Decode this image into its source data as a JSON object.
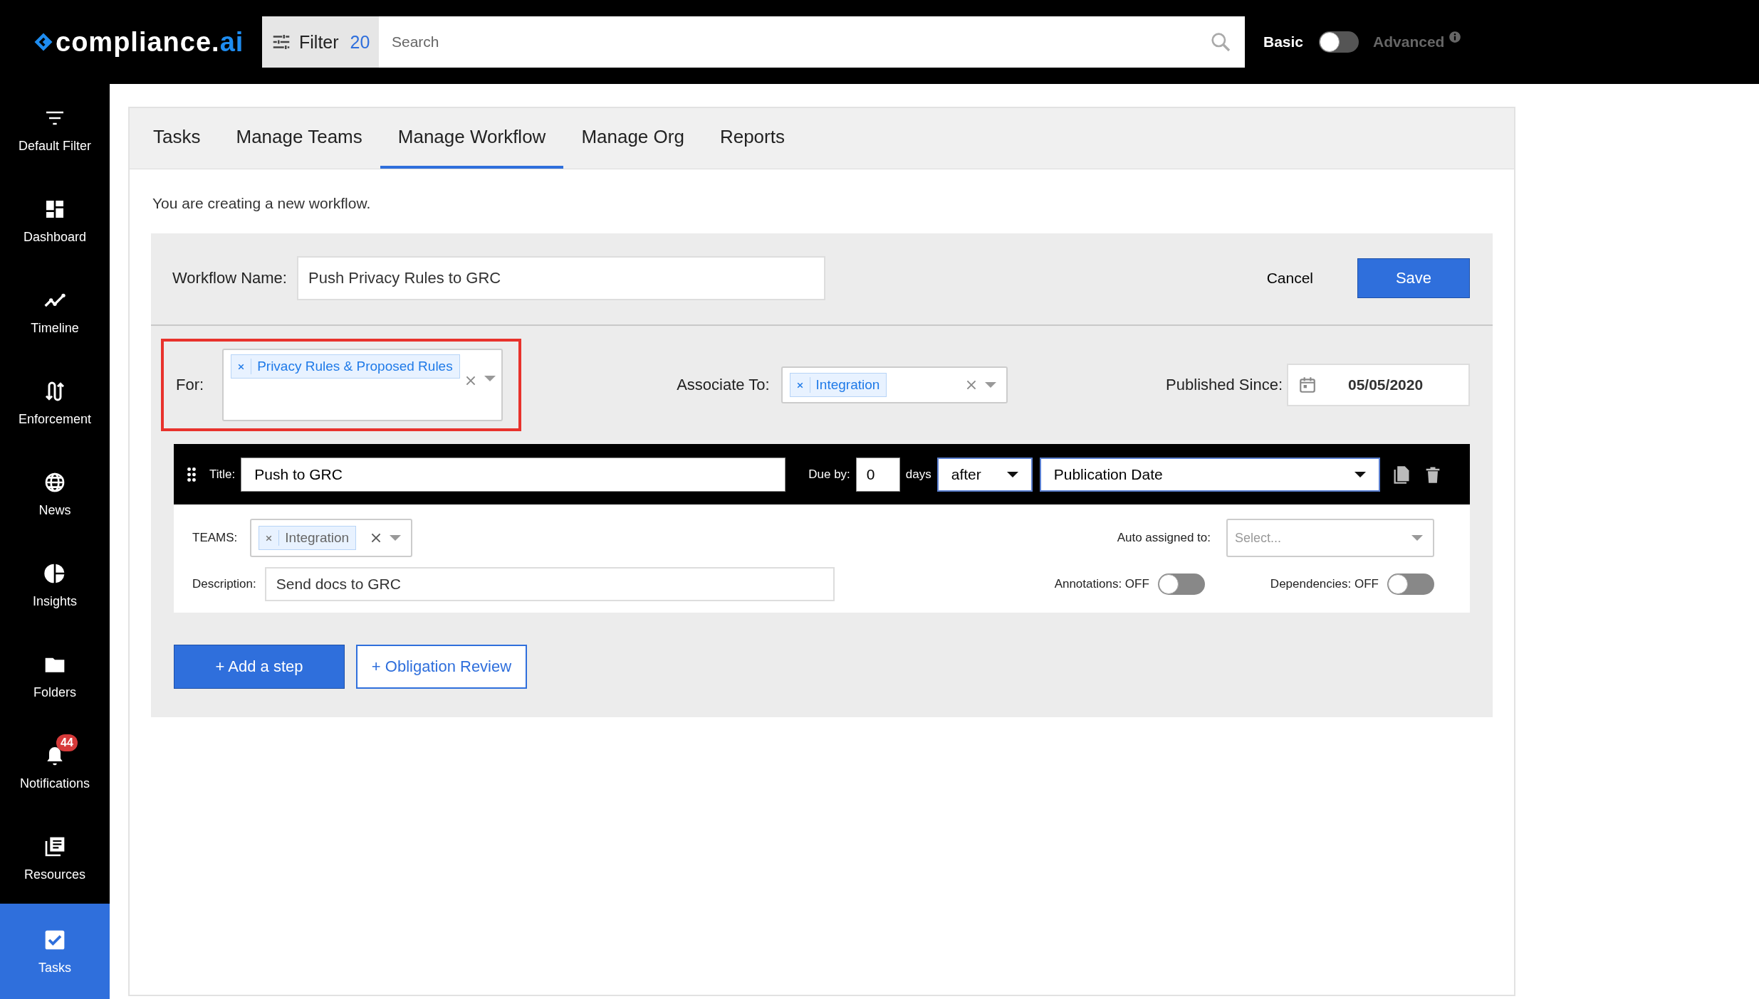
{
  "header": {
    "logo": "compliance.",
    "logo_accent": "ai",
    "filter_label": "Filter",
    "filter_count": "20",
    "search_placeholder": "Search",
    "mode_basic": "Basic",
    "mode_advanced": "Advanced",
    "advanced": false
  },
  "sidebar": {
    "items": [
      {
        "label": "Default Filter",
        "selected": false
      },
      {
        "label": "Dashboard",
        "selected": false
      },
      {
        "label": "Timeline",
        "selected": false
      },
      {
        "label": "Enforcement",
        "selected": false
      },
      {
        "label": "News",
        "selected": false
      },
      {
        "label": "Insights",
        "selected": false
      },
      {
        "label": "Folders",
        "selected": false
      },
      {
        "label": "Notifications",
        "selected": false,
        "badge": "44"
      },
      {
        "label": "Resources",
        "selected": false
      },
      {
        "label": "Tasks",
        "selected": true
      }
    ]
  },
  "tabs": [
    {
      "label": "Tasks",
      "selected": false
    },
    {
      "label": "Manage Teams",
      "selected": false
    },
    {
      "label": "Manage Workflow",
      "selected": true
    },
    {
      "label": "Manage Org",
      "selected": false
    },
    {
      "label": "Reports",
      "selected": false
    }
  ],
  "intro": "You are creating a new workflow.",
  "workflow": {
    "name_label": "Workflow Name:",
    "name_value": "Push Privacy Rules to GRC",
    "cancel": "Cancel",
    "save": "Save",
    "for_label": "For:",
    "for_tags": [
      "Privacy Rules & Proposed Rules"
    ],
    "for_highlighted": true,
    "associate_label": "Associate To:",
    "associate_tags": [
      "Integration"
    ],
    "published_label": "Published Since:",
    "published_value": "05/05/2020"
  },
  "step": {
    "title_label": "Title:",
    "title_value": "Push to GRC",
    "due_label": "Due by:",
    "due_value": "0",
    "days": "days",
    "relation": "after",
    "reference": "Publication Date",
    "teams_label": "TEAMS:",
    "teams_tags": [
      "Integration"
    ],
    "assigned_label": "Auto assigned to:",
    "assigned_placeholder": "Select...",
    "description_label": "Description:",
    "description_value": "Send docs to GRC",
    "annotations_label": "Annotations: OFF",
    "annotations_on": false,
    "dependencies_label": "Dependencies: OFF",
    "dependencies_on": false
  },
  "buttons": {
    "add_step": "+ Add a step",
    "obligation": "+ Obligation Review"
  }
}
